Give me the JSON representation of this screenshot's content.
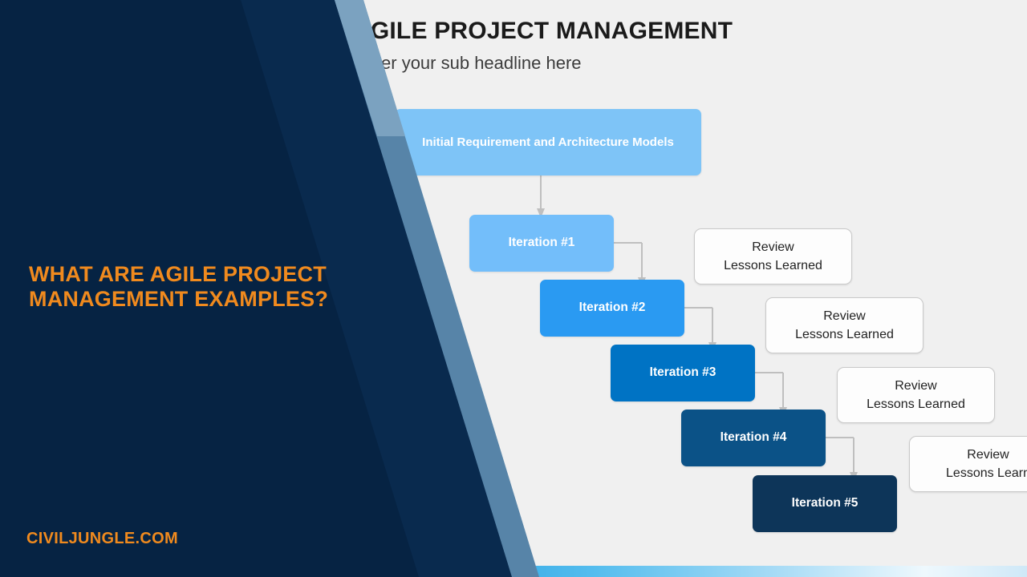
{
  "left_panel": {
    "headline": "WHAT ARE AGILE PROJECT MANAGEMENT EXAMPLES?",
    "brand": "CIVILJUNGLE.COM",
    "accent_color": "#f08a1e",
    "background_color": "#062343",
    "stripe_color": "#5784a8"
  },
  "slide": {
    "title": "AGILE PROJECT MANAGEMENT",
    "subtitle": "Enter your sub headline here",
    "background_color": "#f0f0f0"
  },
  "diagram": {
    "root": {
      "label": "Initial Requirement and Architecture Models",
      "color": "#7ec4f7"
    },
    "iterations": [
      {
        "label": "Iteration #1",
        "color": "#73befa"
      },
      {
        "label": "Iteration #2",
        "color": "#2a9af2"
      },
      {
        "label": "Iteration #3",
        "color": "#0073c4"
      },
      {
        "label": "Iteration #4",
        "color": "#0b5287"
      },
      {
        "label": "Iteration #5",
        "color": "#0d3559"
      }
    ],
    "reviews": [
      {
        "line1": "Review",
        "line2": "Lessons Learned"
      },
      {
        "line1": "Review",
        "line2": "Lessons Learned"
      },
      {
        "line1": "Review",
        "line2": "Lessons Learned"
      },
      {
        "line1": "Review",
        "line2": "Lessons Learn"
      }
    ],
    "connector_color": "#bfbfbf"
  },
  "bottom_bar": {
    "gradient_from": "#0b4c8c",
    "gradient_to": "#eef8fd"
  }
}
